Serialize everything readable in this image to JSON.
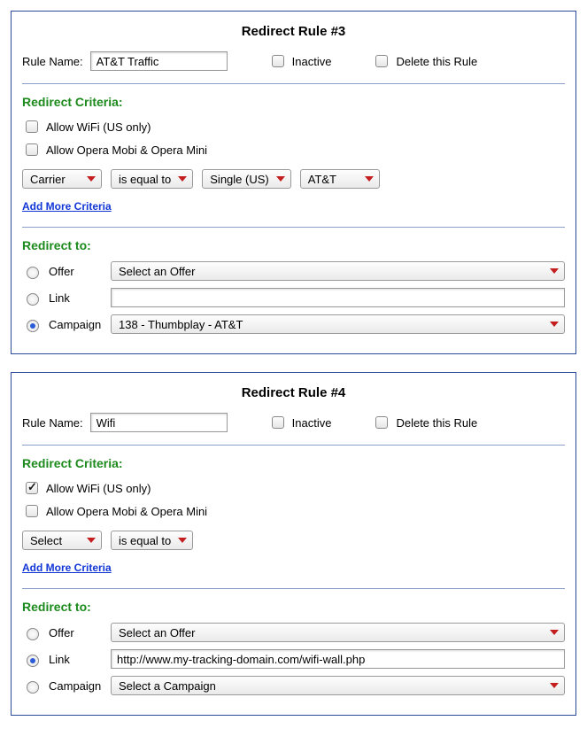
{
  "rules": [
    {
      "title": "Redirect Rule #3",
      "name_label": "Rule Name:",
      "name_value": "AT&T Traffic",
      "inactive_label": "Inactive",
      "inactive_checked": false,
      "delete_label": "Delete this Rule",
      "delete_checked": false,
      "criteria_title": "Redirect Criteria:",
      "allow_wifi_label": "Allow WiFi (US only)",
      "allow_wifi_checked": false,
      "allow_opera_label": "Allow Opera Mobi & Opera Mini",
      "allow_opera_checked": false,
      "criteria_selects": [
        "Carrier",
        "is equal to",
        "Single (US)",
        "AT&T"
      ],
      "add_more_label": "Add More Criteria",
      "redirect_to_title": "Redirect to:",
      "dest": {
        "offer_label": "Offer",
        "offer_select": "Select an Offer",
        "link_label": "Link",
        "link_value": "",
        "campaign_label": "Campaign",
        "campaign_select": "138 - Thumbplay - AT&T",
        "selected": "campaign"
      }
    },
    {
      "title": "Redirect Rule #4",
      "name_label": "Rule Name:",
      "name_value": "Wifi",
      "inactive_label": "Inactive",
      "inactive_checked": false,
      "delete_label": "Delete this Rule",
      "delete_checked": false,
      "criteria_title": "Redirect Criteria:",
      "allow_wifi_label": "Allow WiFi (US only)",
      "allow_wifi_checked": true,
      "allow_opera_label": "Allow Opera Mobi & Opera Mini",
      "allow_opera_checked": false,
      "criteria_selects": [
        "Select",
        "is equal to"
      ],
      "add_more_label": "Add More Criteria",
      "redirect_to_title": "Redirect to:",
      "dest": {
        "offer_label": "Offer",
        "offer_select": "Select an Offer",
        "link_label": "Link",
        "link_value": "http://www.my-tracking-domain.com/wifi-wall.php",
        "campaign_label": "Campaign",
        "campaign_select": "Select a Campaign",
        "selected": "link"
      }
    }
  ]
}
